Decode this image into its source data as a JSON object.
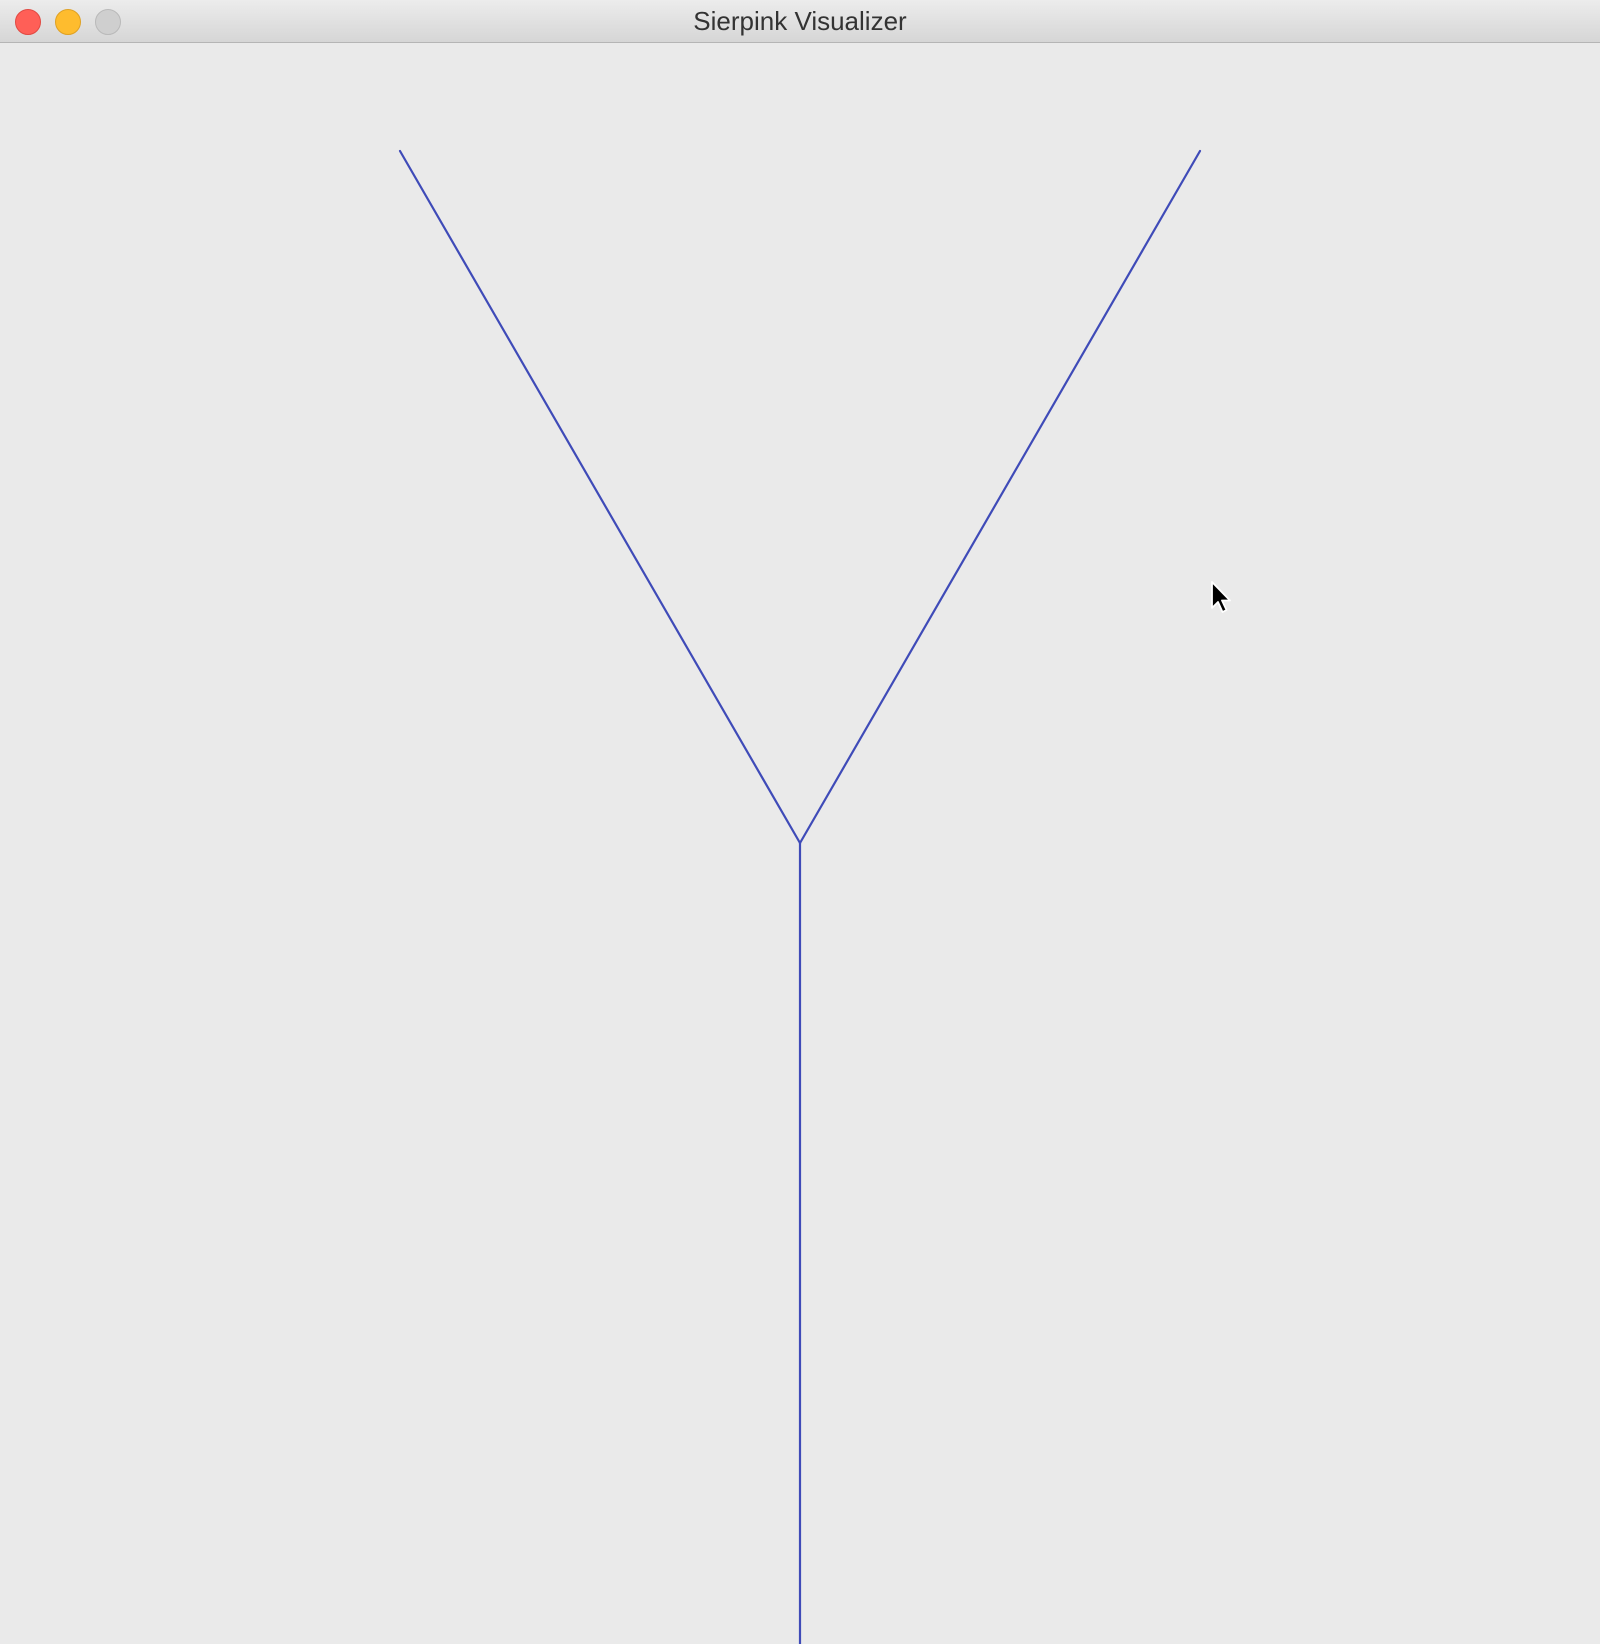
{
  "window": {
    "title": "Sierpink Visualizer",
    "buttons": {
      "close_color": "#FF5F57",
      "minimize_color": "#FEBC2E",
      "zoom_color": "#CFCFCF"
    }
  },
  "canvas": {
    "background": "#EAEAEA",
    "line_color": "#3F4BB8",
    "drawing": "Y-shaped fractal tree, depth 1 (trunk + two branches)"
  }
}
